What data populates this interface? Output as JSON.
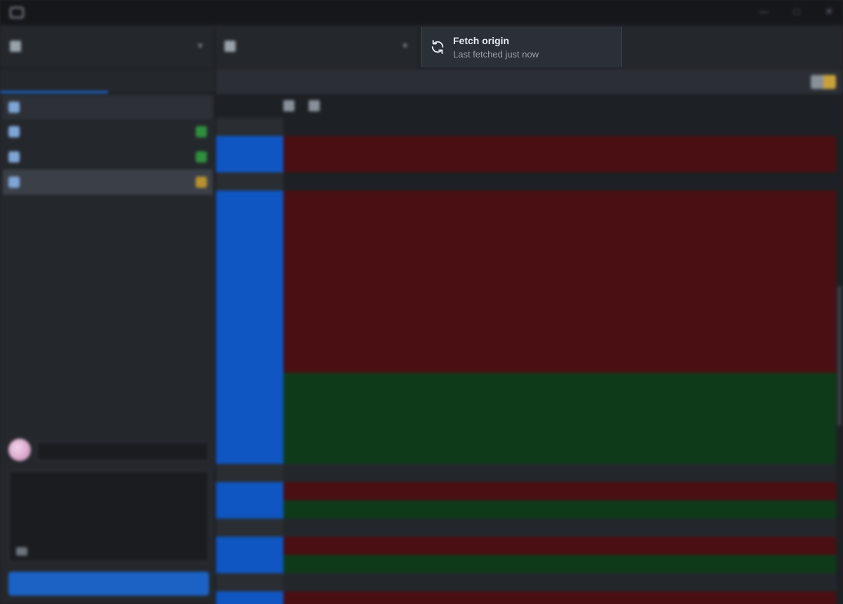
{
  "toast": {
    "title": "Fetch origin",
    "subtitle": "Last fetched just now",
    "icon": "sync-icon"
  },
  "colors": {
    "accent": "#1f6fdb",
    "deleted_bg": "#4a0f12",
    "added_bg": "#0f3a1a",
    "gutter_selected": "#0f56c2"
  }
}
